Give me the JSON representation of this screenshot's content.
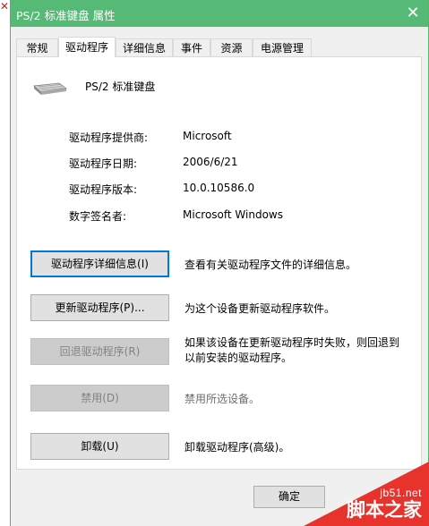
{
  "window": {
    "title": "PS/2 标准键盘 属性",
    "close_glyph": "✕"
  },
  "tabs": [
    {
      "label": "常规",
      "active": false
    },
    {
      "label": "驱动程序",
      "active": true
    },
    {
      "label": "详细信息",
      "active": false
    },
    {
      "label": "事件",
      "active": false
    },
    {
      "label": "资源",
      "active": false
    },
    {
      "label": "电源管理",
      "active": false
    }
  ],
  "device": {
    "name": "PS/2 标准键盘",
    "icon": "keyboard-icon"
  },
  "driver_info": {
    "provider_label": "驱动程序提供商:",
    "provider_value": "Microsoft",
    "date_label": "驱动程序日期:",
    "date_value": "2006/6/21",
    "version_label": "驱动程序版本:",
    "version_value": "10.0.10586.0",
    "signer_label": "数字签名者:",
    "signer_value": "Microsoft Windows"
  },
  "actions": {
    "details_button": "驱动程序详细信息(I)",
    "details_desc": "查看有关驱动程序文件的详细信息。",
    "update_button": "更新驱动程序(P)...",
    "update_desc": "为这个设备更新驱动程序软件。",
    "rollback_button": "回退驱动程序(R)",
    "rollback_desc_line1": "如果该设备在更新驱动程序时失败，则回退到",
    "rollback_desc_line2": "以前安装的驱动程序。",
    "disable_button": "禁用(D)",
    "disable_desc": "禁用所选设备。",
    "uninstall_button": "卸载(U)",
    "uninstall_desc": "卸载驱动程序(高级)。"
  },
  "footer": {
    "ok_button": "确定"
  },
  "watermark": {
    "url": "jb51.net",
    "name": "脚本之家"
  },
  "colors": {
    "titlebar": "#56b976",
    "focus": "#0078d7",
    "watermark": "#e8322c"
  }
}
